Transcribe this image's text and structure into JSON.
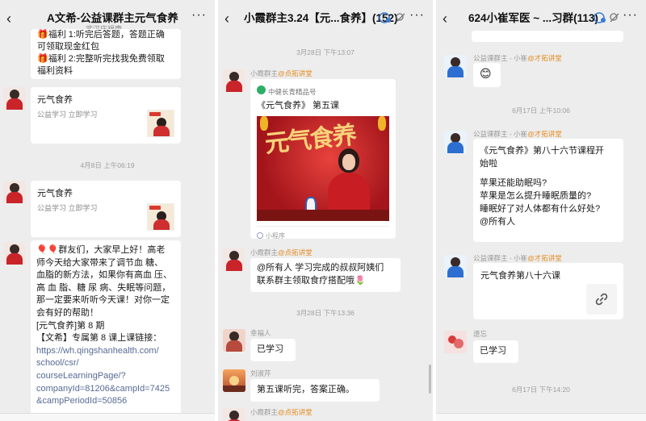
{
  "panel1": {
    "title": "A文希-公益课群主元气食养",
    "subtitle": "武汉庆福康",
    "back": "‹",
    "more": "···",
    "msg_partial": {
      "line1": "🎁福利 1:听完后答题，答题正确",
      "line2": "可领取现金红包",
      "line3": "🎁福利 2:完整听完找我免费领取",
      "line4": "福利资料"
    },
    "card1": {
      "title": "元气食养",
      "desc": "公益学习  立即学习"
    },
    "timestamp": "4月8日 上午06:19",
    "card2": {
      "title": "元气食养",
      "desc": "公益学习  立即学习"
    },
    "long_msg": {
      "l1": "🎈🎈群友们，大家早上好！高老",
      "l2": "师今天给大家带来了调节血 糖、",
      "l3": "血脂的新方法，如果你有高血 压、",
      "l4": "高 血 脂、糖 尿 病、失眠等问题，",
      "l5": "那一定要来听听今天课！对你一定",
      "l6": "会有好的帮助！",
      "l7": "[元气食养]第 8 期",
      "l8": "【文希】专属第 8 课上课链接：",
      "l9": "https://wh.qingshanhealth.com/",
      "l10": "school/csr/",
      "l11": "courseLearningPage/?",
      "l12": "companyId=81206&campId=7425",
      "l13": "&campPeriodId=50856"
    }
  },
  "panel2": {
    "title": "小霞群主3.24【元...食养】(152)",
    "back": "‹",
    "more": "···",
    "timestamp1": "3月28日 下午13:07",
    "nick1": {
      "name": "小霞群主",
      "tag": "@点拓讲堂"
    },
    "mini": {
      "source": "中健长青精品号",
      "title": "《元气食养》 第五课",
      "poster_text": "元气食养",
      "foot": "小程序"
    },
    "nick2": {
      "name": "小霞群主",
      "tag": "@点拓讲堂"
    },
    "msg2": {
      "l1": "@所有人 学习完成的叔叔阿姨们",
      "l2": "联系群主领取食疗搭配哦🌷"
    },
    "timestamp2": "3月28日 下午13:36",
    "nick3": {
      "name": "幸福人"
    },
    "msg3": "已学习",
    "nick4": {
      "name": "刘淑芹"
    },
    "msg4": "第五课听完，答案正确。",
    "nick5": {
      "name": "小霞群主",
      "tag": "@点拓讲堂"
    }
  },
  "panel3": {
    "title": "624小崔军医 ~ ...习群(113)",
    "back": "‹",
    "more": "···",
    "nick1": {
      "name": "公益课群主 - 小崔",
      "tag": "@才拓讲堂"
    },
    "emoji": "😊",
    "timestamp1": "6月17日 上午10:06",
    "nick2": {
      "name": "公益课群主 - 小崔",
      "tag": "@才拓讲堂"
    },
    "msg2": {
      "l1": "《元气食养》第八十六节课程开",
      "l2": "始啦",
      "l3": "苹果还能助眠吗?",
      "l4": "苹果是怎么提升睡眠质量的?",
      "l5": "睡眠好了对人体都有什么好处?",
      "l6": "@所有人"
    },
    "nick3": {
      "name": "公益课群主 - 小崔",
      "tag": "@才拓讲堂"
    },
    "msg3": "元气食养第八十六课",
    "nick4": {
      "name": "遗忘"
    },
    "msg4": "已学习",
    "timestamp2": "6月17日 下午14:20"
  }
}
